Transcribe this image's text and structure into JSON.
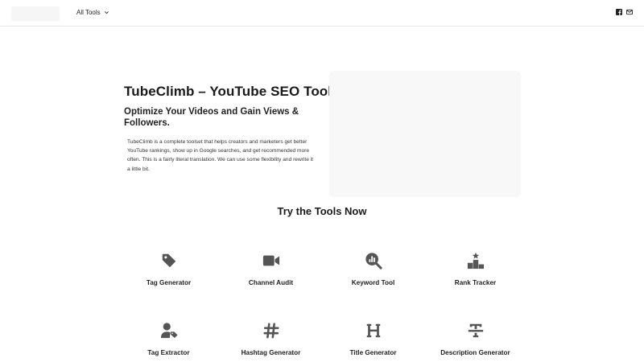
{
  "header": {
    "nav_label": "All Tools",
    "social_icons": [
      "facebook-icon",
      "email-icon"
    ]
  },
  "hero": {
    "title": "TubeClimb – YouTube SEO Tool",
    "subtitle": "Optimize Your Videos and Gain Views & Followers.",
    "description": "TubeClimb is a complete toolset that helps creators and marketers get better YouTube rankings, show up in Google searches, and get recommended more often. This is a fairly literal translation. We can use some flexibility and rewrite it a little bit."
  },
  "tools_section": {
    "title": "Try the Tools Now",
    "tools": [
      {
        "label": "Tag Generator",
        "icon": "tag-icon"
      },
      {
        "label": "Channel Audit",
        "icon": "video-camera-icon"
      },
      {
        "label": "Keyword Tool",
        "icon": "magnifier-chart-icon"
      },
      {
        "label": "Rank Tracker",
        "icon": "podium-star-icon"
      },
      {
        "label": "Tag Extractor",
        "icon": "user-tag-icon"
      },
      {
        "label": "Hashtag Generator",
        "icon": "hashtag-icon"
      },
      {
        "label": "Title Generator",
        "icon": "heading-icon"
      },
      {
        "label": "Description Generator",
        "icon": "text-strikethrough-icon"
      }
    ]
  },
  "colors": {
    "icon": "#555555",
    "text": "#1f1f1f",
    "divider": "#e6e6e6"
  }
}
